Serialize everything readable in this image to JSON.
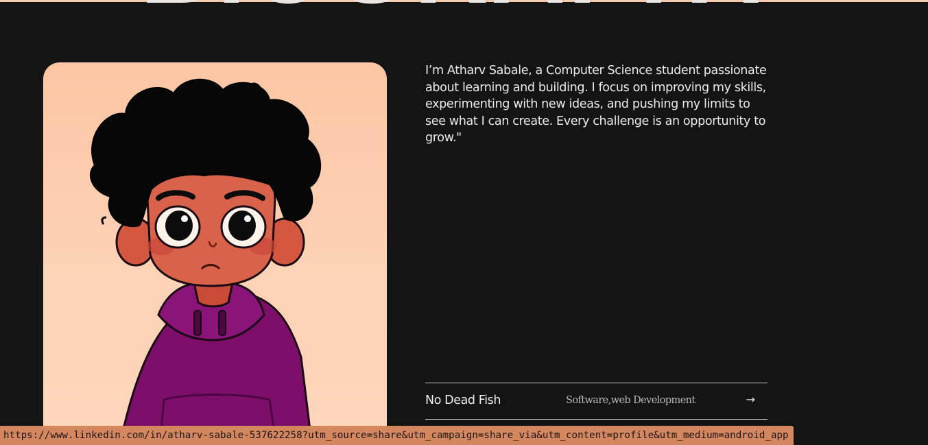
{
  "hero": {
    "heading": "BIOGRAPHY"
  },
  "about": {
    "bio": "I’m Atharv Sabale, a Computer Science student passionate about learning and building. I focus on improving my skills, experimenting with new ideas, and pushing my limits to see what I can create. Every challenge is an opportunity to grow.\""
  },
  "projects": [
    {
      "name": "No Dead Fish",
      "tags": "Software,web Development",
      "arrow": "→"
    }
  ],
  "status_bar": {
    "url": "https://www.linkedin.com/in/atharv-sabale-537622258?utm_source=share&utm_campaign=share_via&utm_content=profile&utm_medium=android_app"
  },
  "colors": {
    "background": "#141414",
    "portrait_bg": "#fdd2b6",
    "status_bar": "#d4875f",
    "hoodie": "#7d0f6b"
  },
  "images": {
    "portrait": "cartoon-avatar-illustration"
  }
}
